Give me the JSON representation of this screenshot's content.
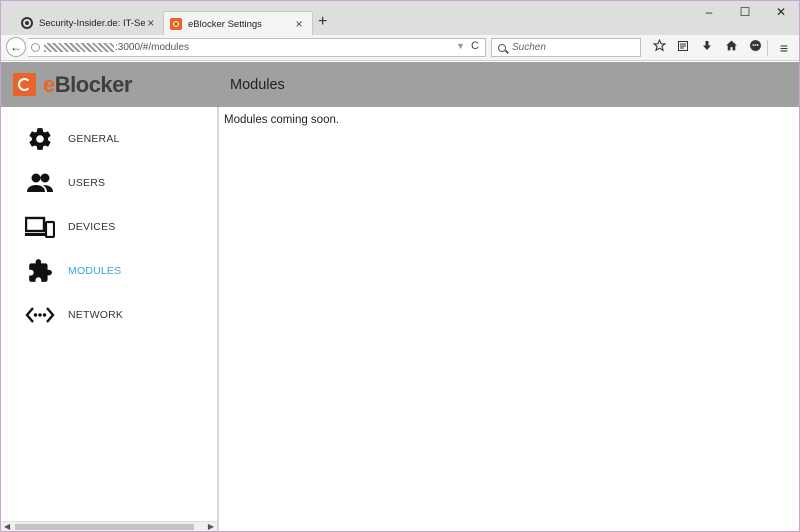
{
  "browser": {
    "tabs": [
      {
        "title": "Security-Insider.de: IT-Sec...",
        "close": "×"
      },
      {
        "title": "eBlocker Settings",
        "close": "×"
      }
    ],
    "new_tab": "+",
    "window_controls": {
      "minimize": "–",
      "maximize": "☐",
      "close": "✕"
    },
    "back": "←",
    "url": ":3000/#/modules",
    "url_dropdown": "▼",
    "reload": "C",
    "search_placeholder": "Suchen",
    "toolbar_icons": [
      "star-icon",
      "reading-list-icon",
      "download-icon",
      "home-icon",
      "chat-icon"
    ],
    "menu": "≡"
  },
  "app": {
    "brand": {
      "prefix": "e",
      "name": "Blocker"
    },
    "page_title": "Modules",
    "content_text": "Modules coming soon.",
    "nav": [
      {
        "label": "GENERAL",
        "icon": "gear-icon",
        "active": false
      },
      {
        "label": "USERS",
        "icon": "users-icon",
        "active": false
      },
      {
        "label": "DEVICES",
        "icon": "devices-icon",
        "active": false
      },
      {
        "label": "MODULES",
        "icon": "puzzle-icon",
        "active": true
      },
      {
        "label": "NETWORK",
        "icon": "network-icon",
        "active": false
      }
    ],
    "colors": {
      "accent": "#e8642c",
      "active_nav": "#34a8d8",
      "header_bg": "#a0a0a0"
    }
  }
}
